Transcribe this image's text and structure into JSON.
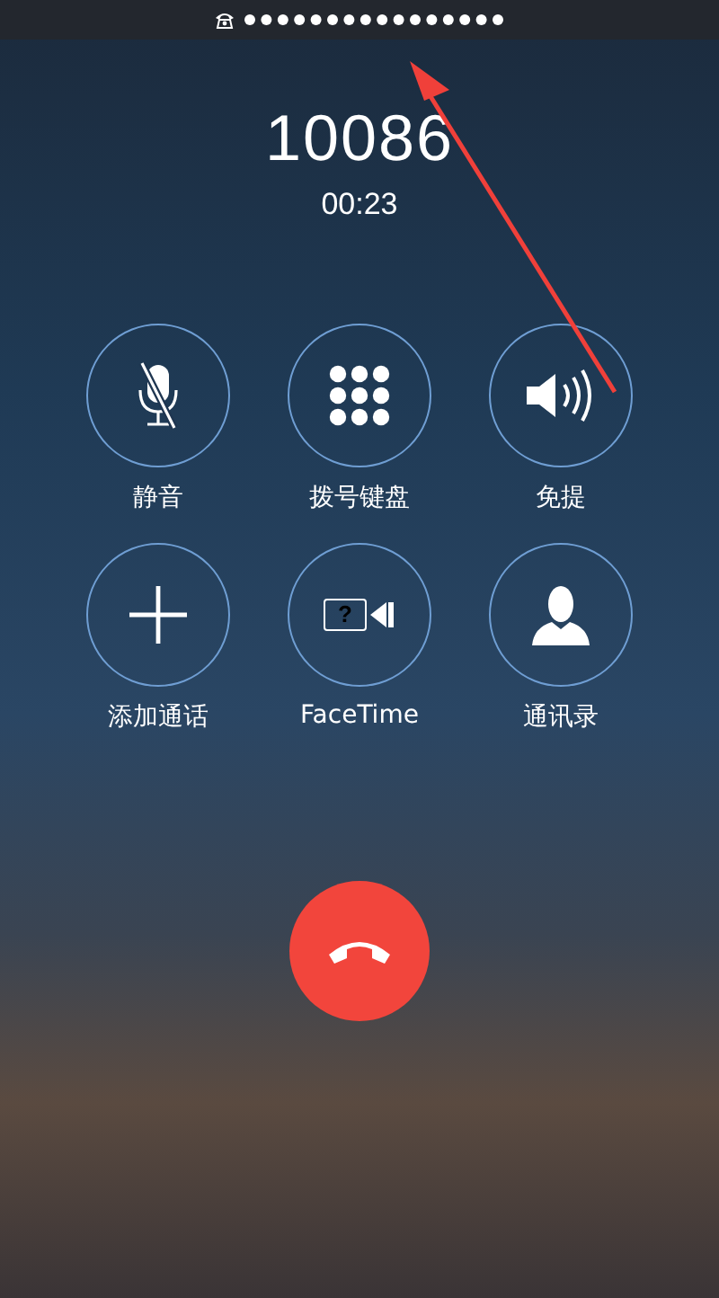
{
  "status_bar": {
    "kind": "call"
  },
  "call": {
    "number": "10086",
    "duration": "00:23"
  },
  "controls": [
    {
      "kind": "mute",
      "label": "静音"
    },
    {
      "kind": "keypad",
      "label": "拨号键盘"
    },
    {
      "kind": "speaker",
      "label": "免提"
    },
    {
      "kind": "add",
      "label": "添加通话"
    },
    {
      "kind": "facetime",
      "label": "FaceTime",
      "icon_text": "?"
    },
    {
      "kind": "contacts",
      "label": "通讯录"
    }
  ],
  "end_call": {
    "kind": "hangup"
  },
  "annotation": {
    "kind": "arrow"
  }
}
